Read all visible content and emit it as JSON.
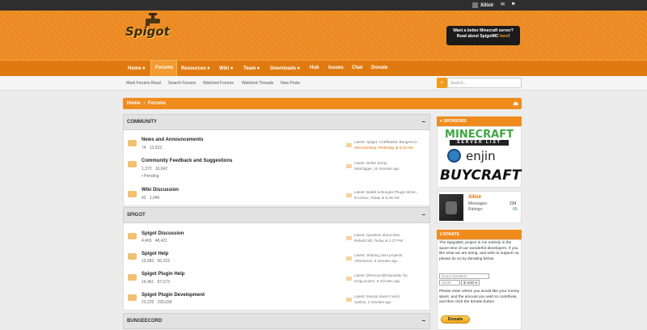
{
  "topbar": {
    "username": "Xilixir"
  },
  "header": {
    "logo_text": "Spigot",
    "promo_line1": "Want a better Minecraft server?",
    "promo_line2_prefix": "Read about SpigotMC ",
    "promo_link": "here",
    "promo_suffix": "!"
  },
  "nav": {
    "items": [
      {
        "label": "Home ▾"
      },
      {
        "label": "Forums"
      },
      {
        "label": "Resources ▾"
      },
      {
        "label": "Wiki ▾"
      },
      {
        "label": "Team ▾"
      },
      {
        "label": "Downloads ▾"
      },
      {
        "label": "Hub"
      },
      {
        "label": "Issues"
      },
      {
        "label": "Chat"
      },
      {
        "label": "Donate"
      }
    ]
  },
  "subnav": {
    "items": [
      "Mark Forums Read",
      "Search Forums",
      "Watched Forums",
      "Watched Threads",
      "New Posts"
    ],
    "search_placeholder": "Search..."
  },
  "breadcrumb": {
    "home": "Home",
    "current": "Forums"
  },
  "categories": [
    {
      "name": "COMMUNITY",
      "forums": [
        {
          "title": "News and Announcements",
          "threads": "74",
          "posts": "12,523",
          "latest_title": "Latest: Spigot, CraftBukkit, BungeeCo...",
          "latest_meta": "electronicboy, Yesterday at 6:18 AM"
        },
        {
          "title": "Community Feedback and Suggestions",
          "threads": "1,372",
          "posts": "16,042",
          "sub": "Pending",
          "latest_title": "Latest: Better Emoji",
          "latest_meta": "MiniDigger, 10 minutes ago"
        },
        {
          "title": "Wiki Discussion",
          "threads": "42",
          "posts": "1,046",
          "latest_title": "Latest: Bukkit & Bungee Plugin Minec...",
          "latest_meta": "RAzorax, Today at 5:49 AM"
        }
      ]
    },
    {
      "name": "SPIGOT",
      "forums": [
        {
          "title": "Spigot Discussion",
          "threads": "4,465",
          "posts": "48,421",
          "latest_title": "Latest: Question about idea",
          "latest_meta": "RebelCraft, Today at 1:27 PM"
        },
        {
          "title": "Spigot Help",
          "threads": "10,583",
          "posts": "66,319",
          "latest_title": "Latest: Sharing Java projects.",
          "latest_meta": "Athena222, 9 minutes ago"
        },
        {
          "title": "Spigot Plugin Help",
          "threads": "15,461",
          "posts": "97,573",
          "latest_title": "Latest: [Resource]Essentials Tip",
          "latest_meta": "KingLinux01, 8 minutes ago"
        },
        {
          "title": "Spigot Plugin Development",
          "threads": "23,225",
          "posts": "230,634",
          "latest_title": "Latest: Events doesn't work",
          "latest_meta": "Apthos, 2 minutes ago"
        }
      ]
    },
    {
      "name": "BUNGEECORD",
      "forums": []
    }
  ],
  "sidebar": {
    "sponsors_title": "SPONSORS",
    "sponsors": [
      "MINECRAFT",
      "SERVER LIST",
      "enjin",
      "BUYCRAFT"
    ],
    "profile": {
      "name": "Xilixir",
      "messages_label": "Messages:",
      "messages": "234",
      "ratings_label": "Ratings:",
      "ratings": "69"
    },
    "donate_title": "DONATE",
    "donate_text": "The SpigotMC project is run entirely in the spare time of our wonderful developers. If you like what we are doing, and wish to support us, please do so by donating below.",
    "donor_placeholder": "Donor Donation",
    "amount": "10.00",
    "currency": "$ USD ▾",
    "donate_text2": "Please enter where you would like your money spent, and the amount you wish to contribute, and then click the donate button.",
    "donate_button": "Donate"
  },
  "colors": {
    "accent": "#ec8a21",
    "topbar": "#2e2e2e",
    "link": "#d96a00"
  }
}
